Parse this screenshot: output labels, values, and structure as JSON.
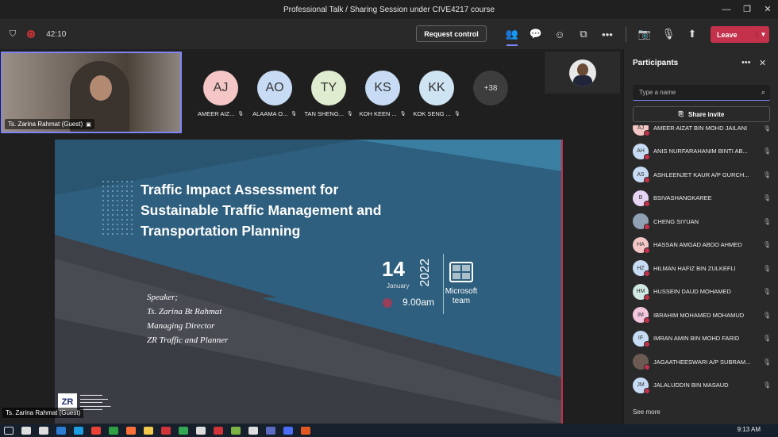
{
  "window": {
    "title": "Professional Talk / Sharing Session under CIVE4217 course",
    "controls": [
      "—",
      "❐",
      "✕"
    ]
  },
  "toolbar": {
    "timer": "42:10",
    "request_control": "Request control",
    "leave": "Leave",
    "icons": [
      "people-icon",
      "chat-icon",
      "reactions-icon",
      "rooms-icon",
      "more-icon",
      "camera-off-icon",
      "mic-off-icon",
      "share-icon"
    ]
  },
  "self_tile": {
    "label": "Ts. Zarina Rahmat (Guest)"
  },
  "gallery": [
    {
      "initials": "AJ",
      "name": "AMEER AIZ...",
      "color": "#f4c6c6"
    },
    {
      "initials": "AO",
      "name": "ALAAMA O...",
      "color": "#c7dcf4"
    },
    {
      "initials": "TY",
      "name": "TAN SHENG...",
      "color": "#dfeccf"
    },
    {
      "initials": "KS",
      "name": "KOH KEEN ...",
      "color": "#c7dcf4"
    },
    {
      "initials": "KK",
      "name": "KOK SENG ...",
      "color": "#cfe4f2"
    }
  ],
  "more_count": "+38",
  "slide": {
    "title_lines": [
      "Traffic Impact Assessment for",
      "Sustainable Traffic Management and",
      "Transportation Planning"
    ],
    "day": "14",
    "month": "January",
    "year": "2022",
    "time": "9.00am",
    "app_lines": [
      "Microsoft",
      "team"
    ],
    "speaker_lines": [
      "Speaker;",
      "Ts. Zarina Bt Rahmat",
      "Managing Director",
      "ZR Traffic and Planner"
    ],
    "logo": "ZR"
  },
  "stage_label": "Ts. Zarina Rahmat (Guest)",
  "participants": {
    "title": "Participants",
    "search_placeholder": "Type a name",
    "share_invite": "Share invite",
    "see_more": "See more",
    "list": [
      {
        "initials": "AJ",
        "name": "AMEER AIZAT BIN MOHD JAILANI",
        "color": "#f4c6c6"
      },
      {
        "initials": "AH",
        "name": "ANIS NURFARAHANIM BINTI AB...",
        "color": "#c7dcf4"
      },
      {
        "initials": "AS",
        "name": "ASHLEENJET KAUR A/P GURCH...",
        "color": "#c7dcf4"
      },
      {
        "initials": "B",
        "name": "BSIVASHANGKAREE",
        "color": "#e7d3f2"
      },
      {
        "initials": "",
        "name": "CHENG SIYUAN",
        "color": "#8fa1b3"
      },
      {
        "initials": "HA",
        "name": "HASSAN AMGAD ABDO AHMED",
        "color": "#f4c6c6"
      },
      {
        "initials": "HZ",
        "name": "HILMAN HAFIZ BIN ZULKEFLI",
        "color": "#c7dcf4"
      },
      {
        "initials": "HM",
        "name": "HUSSEIN DAUD MOHAMED",
        "color": "#cfe8e4"
      },
      {
        "initials": "IM",
        "name": "IBRAHIM MOHAMED MOHAMUD",
        "color": "#f4c6dd"
      },
      {
        "initials": "IF",
        "name": "IMRAN AMIN BIN MOHD FARID",
        "color": "#c7dcf4"
      },
      {
        "initials": "",
        "name": "JAGAATHEESWARI A/P SUBRAM...",
        "color": "#6b5a52"
      },
      {
        "initials": "JM",
        "name": "JALALUDDIN BIN MASAUD",
        "color": "#c7dcf4"
      }
    ]
  },
  "taskbar": {
    "time": "9:13 AM"
  }
}
